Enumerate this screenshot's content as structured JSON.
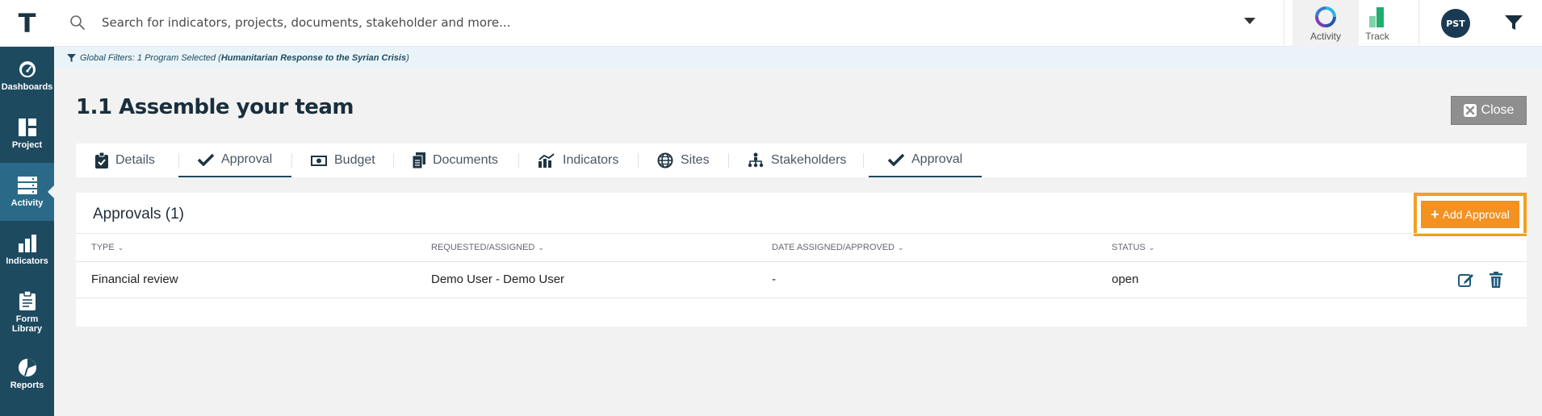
{
  "app": {
    "logo_letter": "T",
    "colors": {
      "navy": "#1e4a60",
      "accent_orange": "#f39121",
      "close_gray": "#8f8f8f"
    }
  },
  "search": {
    "placeholder": "Search for indicators, projects, documents, stakeholder and more...",
    "value": ""
  },
  "topnav": {
    "apps": [
      {
        "label": "Activity",
        "icon": "activity-ring-icon",
        "active": true
      },
      {
        "label": "Track",
        "icon": "track-bars-icon",
        "active": false
      }
    ],
    "avatar_initials": "PST",
    "filter_icon": "filter-icon"
  },
  "sidebar": {
    "items": [
      {
        "label": "Dashboards",
        "icon": "gauge-icon"
      },
      {
        "label": "Project",
        "icon": "grid-icon"
      },
      {
        "label": "Activity",
        "icon": "server-stack-icon",
        "active": true
      },
      {
        "label": "Indicators",
        "icon": "bar-chart-icon"
      },
      {
        "label": "Form Library",
        "icon": "clipboard-icon"
      },
      {
        "label": "Reports",
        "icon": "pie-icon"
      }
    ]
  },
  "global_filter": {
    "prefix": "Global Filters: 1 Program Selected ( ",
    "program": "Humanitarian Response to the Syrian Crisis",
    "suffix": " )"
  },
  "page": {
    "title": "1.1 Assemble your team",
    "close_label": "Close"
  },
  "tabs": [
    {
      "label": "Details",
      "icon": "clipboard-check-icon"
    },
    {
      "label": "Approval",
      "icon": "check-icon",
      "active": true
    },
    {
      "label": "Budget",
      "icon": "money-icon"
    },
    {
      "label": "Documents",
      "icon": "documents-icon"
    },
    {
      "label": "Indicators",
      "icon": "chart-line-icon"
    },
    {
      "label": "Sites",
      "icon": "globe-icon"
    },
    {
      "label": "Stakeholders",
      "icon": "hierarchy-icon"
    },
    {
      "label": "Approval",
      "icon": "check-icon",
      "active": true
    }
  ],
  "approvals": {
    "title": "Approvals (1)",
    "add_label": "Add Approval",
    "columns": [
      "TYPE",
      "REQUESTED/ASSIGNED",
      "DATE ASSIGNED/APPROVED",
      "STATUS"
    ],
    "rows": [
      {
        "type": "Financial review",
        "requested": "Demo User - Demo User",
        "date": "-",
        "status": "open"
      }
    ]
  }
}
